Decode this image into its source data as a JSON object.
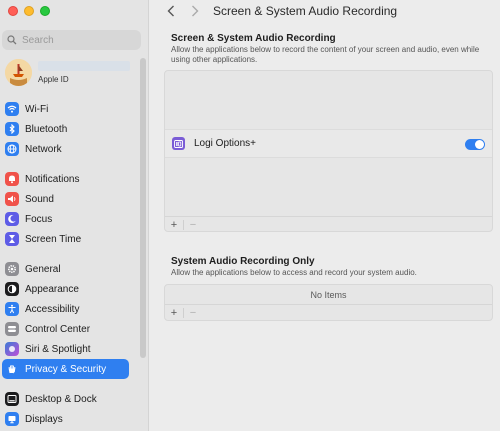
{
  "search": {
    "placeholder": "Search"
  },
  "account": {
    "label": "Apple ID"
  },
  "sidebar": {
    "items": [
      {
        "label": "Wi-Fi",
        "icon": "wifi-icon",
        "color": "#2f7ff0"
      },
      {
        "label": "Bluetooth",
        "icon": "bluetooth-icon",
        "color": "#2f7ff0"
      },
      {
        "label": "Network",
        "icon": "globe-icon",
        "color": "#2f7ff0"
      },
      {
        "label": "Notifications",
        "icon": "bell-icon",
        "color": "#f0524a"
      },
      {
        "label": "Sound",
        "icon": "speaker-icon",
        "color": "#f0524a"
      },
      {
        "label": "Focus",
        "icon": "moon-icon",
        "color": "#5e5ce6"
      },
      {
        "label": "Screen Time",
        "icon": "hourglass-icon",
        "color": "#5e5ce6"
      },
      {
        "label": "General",
        "icon": "gear-icon",
        "color": "#8e8e93"
      },
      {
        "label": "Appearance",
        "icon": "appearance-icon",
        "color": "#1c1c1e"
      },
      {
        "label": "Accessibility",
        "icon": "accessibility-icon",
        "color": "#2f7ff0"
      },
      {
        "label": "Control Center",
        "icon": "control-center-icon",
        "color": "#8e8e93"
      },
      {
        "label": "Siri & Spotlight",
        "icon": "siri-icon",
        "color": "#a050e0"
      },
      {
        "label": "Privacy & Security",
        "icon": "hand-icon",
        "color": "#2f7ff0"
      },
      {
        "label": "Desktop & Dock",
        "icon": "dock-icon",
        "color": "#1c1c1e"
      },
      {
        "label": "Displays",
        "icon": "display-icon",
        "color": "#2f7ff0"
      }
    ],
    "selected": "Privacy & Security"
  },
  "header": {
    "title": "Screen & System Audio Recording"
  },
  "section1": {
    "title": "Screen & System Audio Recording",
    "description": "Allow the applications below to record the content of your screen and audio, even while using other applications.",
    "apps": [
      {
        "name": "Logi Options+",
        "enabled": true
      }
    ],
    "add_label": "+",
    "remove_label": "−"
  },
  "section2": {
    "title": "System Audio Recording Only",
    "description": "Allow the applications below to access and record your system audio.",
    "empty_text": "No Items",
    "add_label": "+",
    "remove_label": "−"
  }
}
